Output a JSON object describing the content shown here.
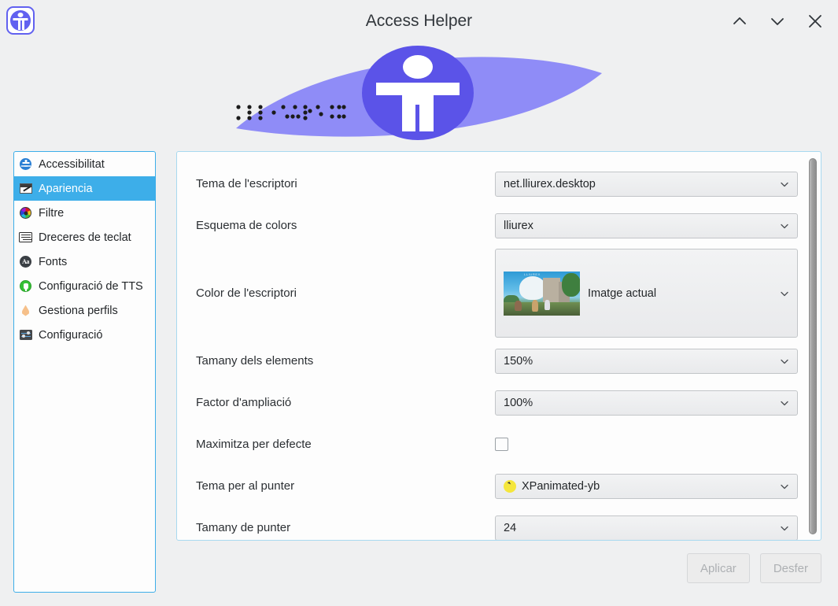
{
  "window": {
    "title": "Access Helper",
    "app_icon": "accessibility-person-icon",
    "controls": [
      {
        "name": "minimize-button",
        "icon": "chevron-up-icon"
      },
      {
        "name": "maximize-button",
        "icon": "chevron-down-icon"
      },
      {
        "name": "close-button",
        "icon": "close-x-icon"
      }
    ]
  },
  "banner": {
    "logo": "accessibility-person-icon",
    "shape": "lens-ellipse",
    "accent_light": "#8f8cf7",
    "accent_dark": "#5b53e8",
    "braille_left": "braille-dots-left",
    "braille_right": "braille-dots-right"
  },
  "sidebar": {
    "items": [
      {
        "label": "Accessibilitat",
        "icon": "accessibility-icon",
        "selected": false
      },
      {
        "label": "Apariencia",
        "icon": "appearance-icon",
        "selected": true
      },
      {
        "label": "Filtre",
        "icon": "color-filter-icon",
        "selected": false
      },
      {
        "label": "Dreceres de teclat",
        "icon": "keyboard-icon",
        "selected": false
      },
      {
        "label": "Fonts",
        "icon": "fonts-icon",
        "selected": false
      },
      {
        "label": "Configuració de TTS",
        "icon": "tts-icon",
        "selected": false
      },
      {
        "label": "Gestiona perfils",
        "icon": "profiles-drop-icon",
        "selected": false
      },
      {
        "label": "Configuració",
        "icon": "settings-sliders-icon",
        "selected": false
      }
    ]
  },
  "main": {
    "fields": [
      {
        "label": "Tema de l'escriptori",
        "value": "net.lliurex.desktop",
        "type": "combo"
      },
      {
        "label": "Esquema de colors",
        "value": "lliurex",
        "type": "combo"
      },
      {
        "label": "Color de l'escriptori",
        "value": "Imatge actual",
        "type": "combo-image"
      },
      {
        "label": "Tamany dels elements",
        "value": "150%",
        "type": "combo"
      },
      {
        "label": "Factor d'ampliació",
        "value": "100%",
        "type": "combo"
      },
      {
        "label": "Maximitza per defecte",
        "value": "",
        "type": "checkbox",
        "checked": false
      },
      {
        "label": "Tema per al punter",
        "value": "XPanimated-yb",
        "type": "combo-cursor"
      },
      {
        "label": "Tamany de punter",
        "value": "24",
        "type": "combo"
      }
    ],
    "wallpaper_watermark": "LLIUREX"
  },
  "footer": {
    "apply_label": "Aplicar",
    "undo_label": "Desfer"
  },
  "colors": {
    "selection": "#3daee9",
    "panel_border": "#a8d9f0",
    "window_bg": "#eff0f1",
    "accent_purple": "#6161f0"
  }
}
